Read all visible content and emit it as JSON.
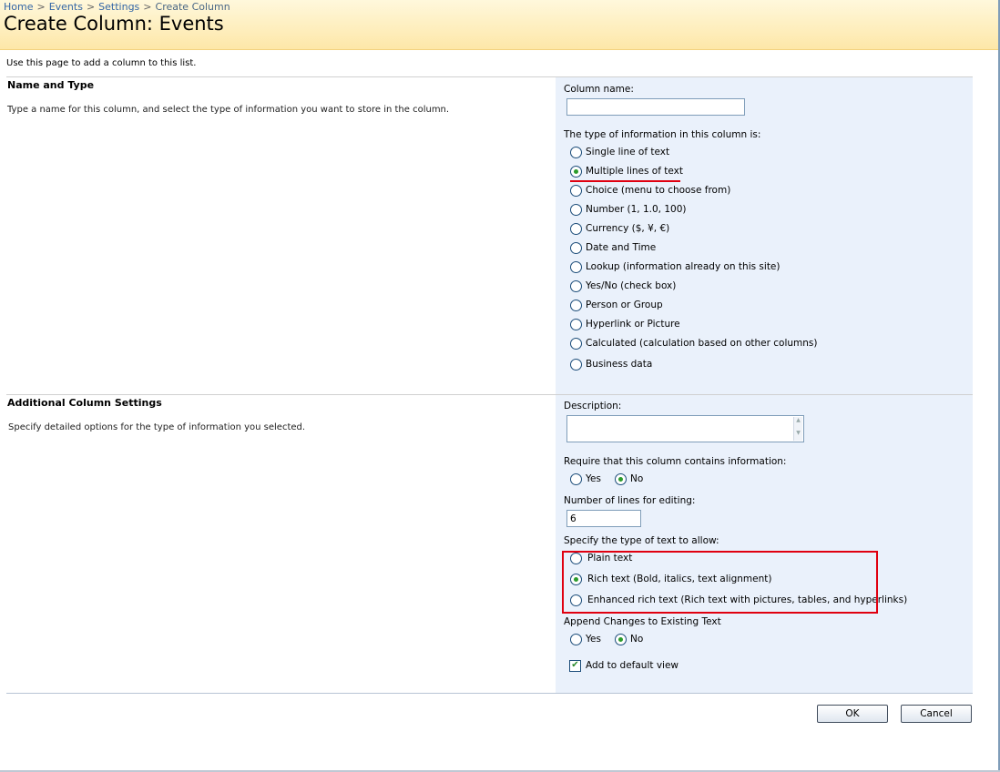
{
  "breadcrumb": {
    "items": [
      "Home",
      "Events",
      "Settings",
      "Create Column"
    ],
    "separator": ">"
  },
  "page": {
    "title": "Create Column: Events",
    "intro": "Use this page to add a column to this list."
  },
  "name_and_type": {
    "title": "Name and Type",
    "description": "Type a name for this column, and select the type of information you want to store in the column.",
    "column_name_label": "Column name:",
    "column_name_value": "",
    "type_label": "The type of information in this column is:",
    "types": [
      "Single line of text",
      "Multiple lines of text",
      "Choice (menu to choose from)",
      "Number (1, 1.0, 100)",
      "Currency ($, ¥, €)",
      "Date and Time",
      "Lookup (information already on this site)",
      "Yes/No (check box)",
      "Person or Group",
      "Hyperlink or Picture",
      "Calculated (calculation based on other columns)",
      "Business data"
    ],
    "selected_type": "Multiple lines of text"
  },
  "additional": {
    "title": "Additional Column Settings",
    "description": "Specify detailed options for the type of information you selected.",
    "description_label": "Description:",
    "description_value": "",
    "require_label": "Require that this column contains information:",
    "require_options": [
      "Yes",
      "No"
    ],
    "require_selected": "No",
    "lines_label": "Number of lines for editing:",
    "lines_value": "6",
    "text_type_label": "Specify the type of text to allow:",
    "text_types": [
      "Plain text",
      "Rich text (Bold, italics, text alignment)",
      "Enhanced rich text (Rich text with pictures, tables, and hyperlinks)"
    ],
    "text_type_selected": "Rich text (Bold, italics, text alignment)",
    "append_label": "Append Changes to Existing Text",
    "append_options": [
      "Yes",
      "No"
    ],
    "append_selected": "No",
    "default_view_label": "Add to default view",
    "default_view_checked": true
  },
  "buttons": {
    "ok": "OK",
    "cancel": "Cancel"
  },
  "colors": {
    "header_gradient_start": "#fff8dc",
    "header_gradient_end": "#fde7a8",
    "panel_bg": "#eaf1fb",
    "link": "#3366a6",
    "highlight_red": "#e00010",
    "radio_selected": "#2b9b2b"
  }
}
